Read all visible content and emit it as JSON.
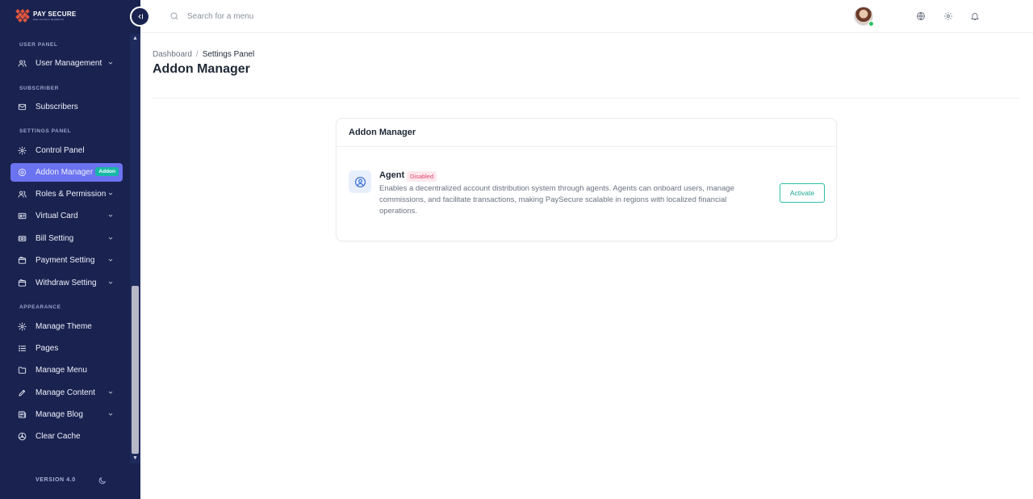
{
  "brand": {
    "name": "PAY SECURE",
    "tagline": "Easy security in all platforms"
  },
  "colors": {
    "sidebar_bg": "#1a2350",
    "active_item": "#6c73f0",
    "accent": "#17b8a6",
    "disabled_badge": "#e1446f"
  },
  "sidebar": {
    "sections": [
      {
        "label": "USER PANEL"
      },
      {
        "label": "SUBSCRIBER"
      },
      {
        "label": "SETTINGS PANEL"
      },
      {
        "label": "APPEARANCE"
      }
    ],
    "items": [
      {
        "label": "User Management",
        "icon": "users-icon",
        "has_chevron": true
      },
      {
        "label": "Subscribers",
        "icon": "mail-icon",
        "has_chevron": false
      },
      {
        "label": "Control Panel",
        "icon": "gear-icon",
        "has_chevron": false
      },
      {
        "label": "Addon Manager",
        "icon": "addon-icon",
        "has_chevron": false,
        "active": true,
        "badge": "Addon"
      },
      {
        "label": "Roles & Permission",
        "icon": "users-icon",
        "has_chevron": true
      },
      {
        "label": "Virtual Card",
        "icon": "id-card-icon",
        "has_chevron": true
      },
      {
        "label": "Bill Setting",
        "icon": "bill-icon",
        "has_chevron": true
      },
      {
        "label": "Payment Setting",
        "icon": "wallet-icon",
        "has_chevron": true
      },
      {
        "label": "Withdraw Setting",
        "icon": "wallet-icon",
        "has_chevron": true
      },
      {
        "label": "Manage Theme",
        "icon": "gear-icon",
        "has_chevron": false
      },
      {
        "label": "Pages",
        "icon": "list-icon",
        "has_chevron": false
      },
      {
        "label": "Manage Menu",
        "icon": "folder-icon",
        "has_chevron": false
      },
      {
        "label": "Manage Content",
        "icon": "pencil-icon",
        "has_chevron": true
      },
      {
        "label": "Manage Blog",
        "icon": "newspaper-icon",
        "has_chevron": true
      },
      {
        "label": "Clear Cache",
        "icon": "radiation-icon",
        "has_chevron": false
      }
    ],
    "version": "VERSION 4.0"
  },
  "topbar": {
    "search_placeholder": "Search for a menu",
    "icons": [
      "globe-icon",
      "gear-icon",
      "bell-icon"
    ]
  },
  "breadcrumb": {
    "parent": "Dashboard",
    "separator": "/",
    "current": "Settings Panel"
  },
  "page_title": "Addon Manager",
  "card": {
    "title": "Addon Manager",
    "addon": {
      "name": "Agent",
      "status": "Disabled",
      "description": "Enables a decentralized account distribution system through agents. Agents can onboard users, manage commissions, and facilitate transactions, making PaySecure scalable in regions with localized financial operations.",
      "action_label": "Activate"
    }
  }
}
